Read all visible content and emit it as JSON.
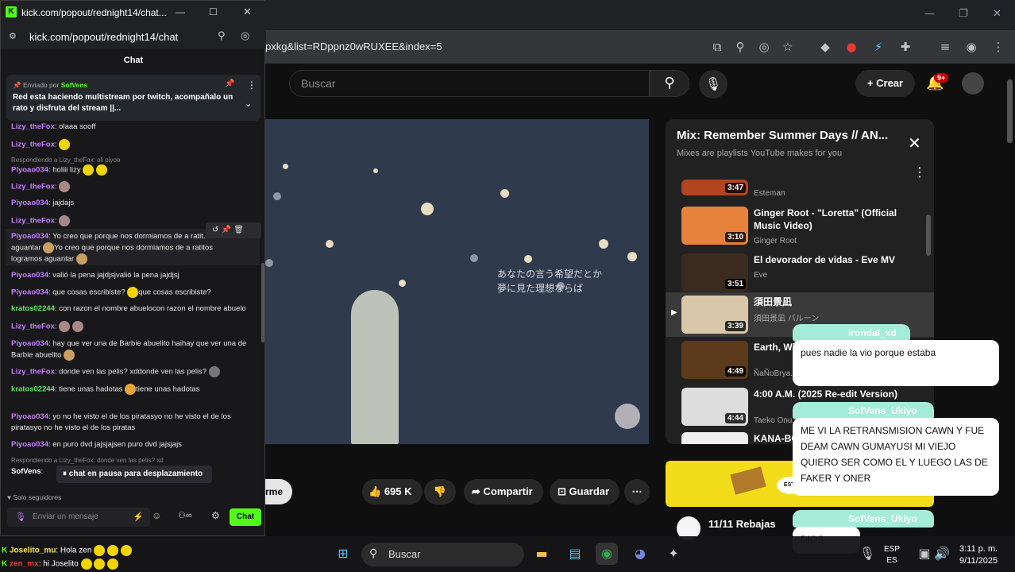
{
  "kick": {
    "window_title": "kick.com/popout/rednight14/chat...",
    "url": "kick.com/popout/rednight14/chat",
    "chat_header": "Chat",
    "pinned": {
      "sent_by_label": "Enviado por",
      "user": "SofVens",
      "text": "Red esta haciendo multistream por twitch, acompañalo un rato y disfruta del stream",
      "text_end": "||..."
    },
    "messages": [
      {
        "user": "Lizy_theFox",
        "text": ": olaaa sooff"
      },
      {
        "user": "Lizy_theFox",
        "text": ":"
      },
      {
        "reply": "Respondiendo a Lizy_theFox: oli piyoo"
      },
      {
        "user": "Piyoao034",
        "text": ": holiii lizy"
      },
      {
        "user": "Lizy_theFox",
        "text": ":"
      },
      {
        "user": "Piyoao034",
        "text": ": jajdajs"
      },
      {
        "user": "Lizy_theFox",
        "text": ":"
      },
      {
        "user": "Piyoao034",
        "text": ": Yo creo que porque nos dormiamos de a ratit..."
      },
      {
        "text": "aguantar"
      },
      {
        "text": "Yo creo que porque nos dormiamos de a ratitos"
      },
      {
        "text": "logramos aguantar"
      },
      {
        "user": "Piyoao034",
        "text": ": valió la pena jajdjsjvalió la pena jajdjsj"
      },
      {
        "user": "Piyoao034",
        "text": ": que cosas escribiste?"
      },
      {
        "text": "que cosas escribiste?"
      },
      {
        "user": "kratos02244",
        "text": ": con razon el nombre abuelocon razon el nombre abuelo"
      },
      {
        "user": "Lizy_theFox",
        "text": ":"
      },
      {
        "user": "Piyoao034",
        "text": ": hay que ver una de Barbie abuelito haihay que ver una de"
      },
      {
        "text": "Barbie abuelito"
      },
      {
        "user": "Lizy_theFox",
        "text": ": donde ven las pelis? xddonde ven las pelis?"
      },
      {
        "user": "kratos02244",
        "text": ": tiene unas hadotas"
      },
      {
        "text": "tiene unas hadotas"
      },
      {
        "user": "Piyoao034",
        "text": ": yo no he visto el de los piratasyo no he visto el de los"
      },
      {
        "text": "piratasyo no he visto el de los piratas"
      },
      {
        "user": "Piyoao034",
        "text": ": en puro dvd jajsjajsen puro dvd jajsjajs"
      },
      {
        "reply": "Respondiendo a Lizy_theFox: donde ven las pelis? xd"
      },
      {
        "user": "SofVens",
        "text": ":"
      }
    ],
    "pause_label": "chat en pausa para desplazamiento",
    "followers_only": "Solo seguidores",
    "input_placeholder": "Enviar un mensaje",
    "chat_button": "Chat"
  },
  "browser": {
    "url": "pxkg&list=RDppnz0wRUXEE&index=5"
  },
  "youtube": {
    "search_placeholder": "Buscar",
    "create_label": "Crear",
    "notif_count": "9+",
    "lyrics": [
      "あなたの言う希望だとか",
      "夢に見た理想ならば"
    ],
    "actions": {
      "like_count": "695 K",
      "share": "Compartir",
      "save": "Guardar",
      "subscribe_partial": "rme"
    },
    "playlist": {
      "title": "Mix: Remember Summer Days // AN...",
      "subtitle": "Mixes are playlists YouTube makes for you",
      "items": [
        {
          "duration": "3:47",
          "title": "",
          "channel": "Esteman"
        },
        {
          "duration": "3:10",
          "title": "Ginger Root - \"Loretta\" (Official Music Video)",
          "channel": "Ginger Root"
        },
        {
          "duration": "3:51",
          "title": "El devorador de vidas - Eve MV",
          "channel": "Eve"
        },
        {
          "duration": "3:39",
          "title": "須田景凪",
          "channel": "須田景凪 バルーン"
        },
        {
          "duration": "4:49",
          "title": "Earth, Wi... Wonderla...",
          "channel": "ÑaÑoBrya..."
        },
        {
          "duration": "4:44",
          "title": "4:00 A.M. (2025 Re-edit Version)",
          "channel": "Taeko Onu..."
        },
        {
          "duration": "",
          "title": "KANA-BO...",
          "channel": ""
        }
      ]
    },
    "rebajas": "11/11 Rebajas",
    "ad_tag": "ESTA"
  },
  "overlay_chat": [
    {
      "user": "irondal_xd",
      "text": "pues nadie la vio  porque estaba"
    },
    {
      "user": "SofVens_Ukiyo",
      "text": "ME VI LA RETRANSMISION CAWN Y FUE DEAM CAWN GUMAYUSI MI VIEJO QUIERO SER COMO EL Y LUEGO LAS DE FAKER Y ONER"
    },
    {
      "user": "SofVens_Ukiyo",
      "text": "DIOS"
    }
  ],
  "bottom_chat": [
    {
      "user": "Joselito_mu",
      "text": ": Hola zen"
    },
    {
      "user": "zen_mx",
      "text": ": hi Joselito"
    }
  ],
  "taskbar": {
    "search": "Buscar",
    "lang1": "ESP",
    "lang2": "ES",
    "time": "3:11 p. m.",
    "date": "9/11/2025"
  }
}
